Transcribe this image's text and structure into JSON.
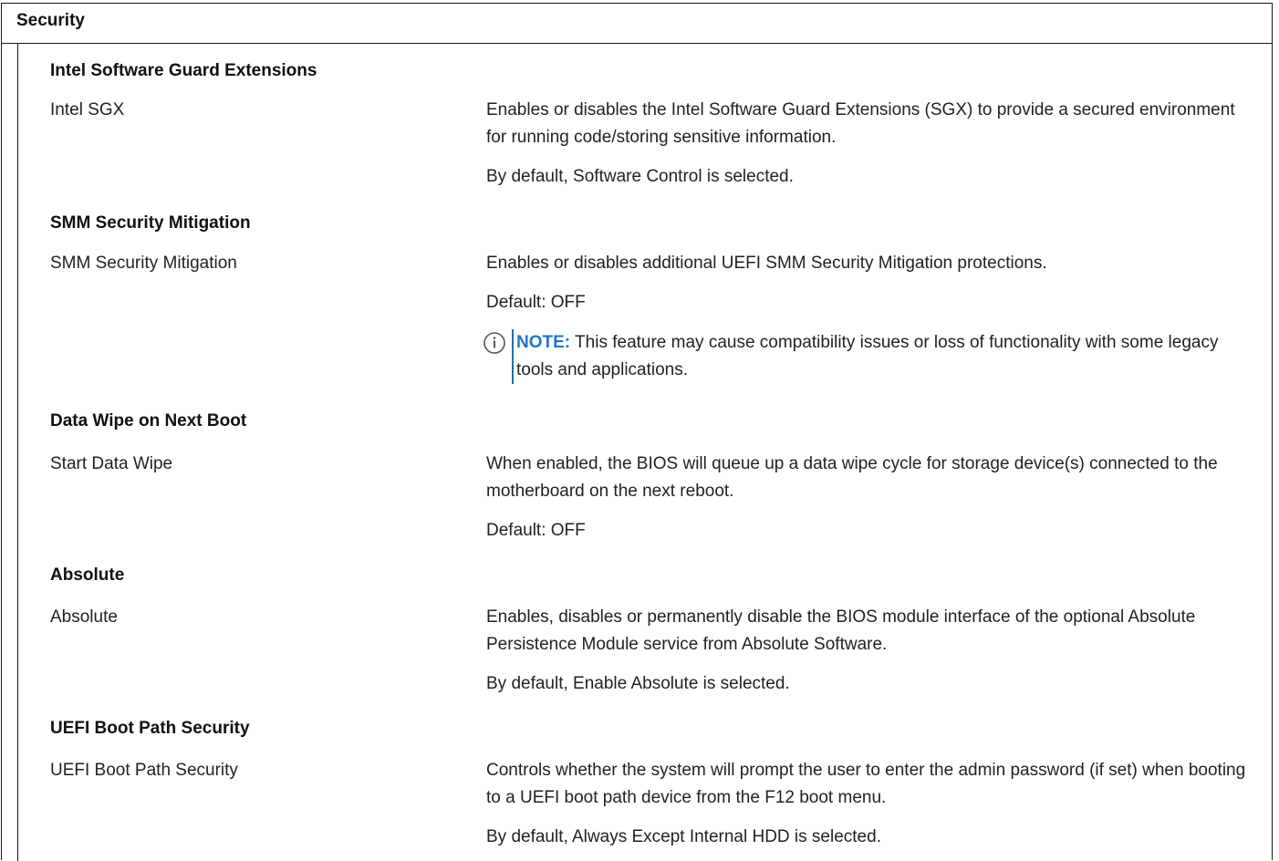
{
  "page": {
    "title": "Security"
  },
  "sections": [
    {
      "heading": "Intel Software Guard Extensions",
      "label": "Intel SGX",
      "description": [
        "Enables or disables the Intel Software Guard Extensions (SGX) to provide a secured environment for running code/storing sensitive information.",
        "By default, Software Control is selected."
      ]
    },
    {
      "heading": "SMM Security Mitigation",
      "label": "SMM Security Mitigation",
      "description": [
        "Enables or disables additional UEFI SMM Security Mitigation protections.",
        "Default: OFF"
      ],
      "note": {
        "icon": "info-icon",
        "label": "NOTE:",
        "text": " This feature may cause compatibility issues or loss of functionality with some legacy tools and applications."
      }
    },
    {
      "heading": "Data Wipe on Next Boot",
      "label": "Start Data Wipe",
      "description": [
        "When enabled, the BIOS will queue up a data wipe cycle for storage device(s) connected to the motherboard on the next reboot.",
        "Default: OFF"
      ]
    },
    {
      "heading": "Absolute",
      "label": "Absolute",
      "description": [
        "Enables, disables or permanently disable the BIOS module interface of the optional Absolute Persistence Module service from Absolute Software.",
        "By default, Enable Absolute is selected."
      ]
    },
    {
      "heading": "UEFI Boot Path Security",
      "label": "UEFI Boot Path Security",
      "description": [
        "Controls whether the system will prompt the user to enter the admin password (if set) when booting to a UEFI boot path device from the F12 boot menu.",
        "By default, Always Except Internal HDD is selected."
      ]
    }
  ],
  "colors": {
    "note_accent": "#1f75c4",
    "border": "#1a1a1a"
  }
}
